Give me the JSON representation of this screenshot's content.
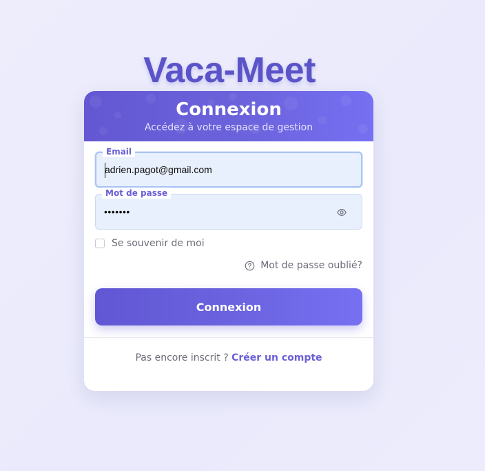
{
  "app": {
    "brand": "Vaca-Meet"
  },
  "login": {
    "title": "Connexion",
    "subtitle": "Accédez à votre espace de gestion",
    "email": {
      "label": "Email",
      "value": "adrien.pagot@gmail.com"
    },
    "password": {
      "label": "Mot de passe",
      "value": "•••••••"
    },
    "remember_label": "Se souvenir de moi",
    "forgot_label": "Mot de passe oublié?",
    "submit_label": "Connexion",
    "signup_prompt": "Pas encore inscrit ?",
    "signup_link": "Créer un compte"
  },
  "icons": {
    "password_toggle": "eye-icon",
    "forgot": "help-circle-icon"
  },
  "colors": {
    "accent": "#6a5fd6",
    "brand": "#5b54c9",
    "background": "#ededfc"
  }
}
